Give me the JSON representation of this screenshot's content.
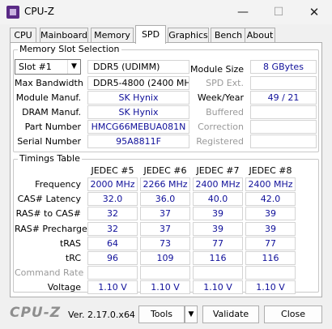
{
  "window": {
    "title": "CPU-Z",
    "minimize": "—",
    "maximize": "☐",
    "close": "✕"
  },
  "tabs": [
    "CPU",
    "Mainboard",
    "Memory",
    "SPD",
    "Graphics",
    "Bench",
    "About"
  ],
  "active_tab": "SPD",
  "slot_group": {
    "title": "Memory Slot Selection",
    "slot_select": "Slot #1",
    "memory_type": "DDR5 (UDIMM)",
    "max_bandwidth_label": "Max Bandwidth",
    "max_bandwidth": "DDR5-4800 (2400 MHz)",
    "manuf_label": "Module Manuf.",
    "manuf": "SK Hynix",
    "dram_manuf_label": "DRAM Manuf.",
    "dram_manuf": "SK Hynix",
    "part_label": "Part Number",
    "part": "HMCG66MEBUA081N",
    "serial_label": "Serial Number",
    "serial": "95A8811F",
    "module_size_label": "Module Size",
    "module_size": "8 GBytes",
    "spd_ext_label": "SPD Ext.",
    "spd_ext": "",
    "week_year_label": "Week/Year",
    "week_year": "49 / 21",
    "buffered_label": "Buffered",
    "buffered": "",
    "correction_label": "Correction",
    "correction": "",
    "registered_label": "Registered",
    "registered": ""
  },
  "timings": {
    "title": "Timings Table",
    "columns": [
      "JEDEC #5",
      "JEDEC #6",
      "JEDEC #7",
      "JEDEC #8"
    ],
    "rows": [
      {
        "label": "Frequency",
        "values": [
          "2000 MHz",
          "2266 MHz",
          "2400 MHz",
          "2400 MHz"
        ]
      },
      {
        "label": "CAS# Latency",
        "values": [
          "32.0",
          "36.0",
          "40.0",
          "42.0"
        ]
      },
      {
        "label": "RAS# to CAS#",
        "values": [
          "32",
          "37",
          "39",
          "39"
        ]
      },
      {
        "label": "RAS# Precharge",
        "values": [
          "32",
          "37",
          "39",
          "39"
        ]
      },
      {
        "label": "tRAS",
        "values": [
          "64",
          "73",
          "77",
          "77"
        ]
      },
      {
        "label": "tRC",
        "values": [
          "96",
          "109",
          "116",
          "116"
        ]
      },
      {
        "label": "Command Rate",
        "values": [
          "",
          "",
          "",
          ""
        ]
      },
      {
        "label": "Voltage",
        "values": [
          "1.10 V",
          "1.10 V",
          "1.10 V",
          "1.10 V"
        ]
      }
    ]
  },
  "footer": {
    "logo": "CPU-Z",
    "version": "Ver. 2.17.0.x64",
    "tools": "Tools",
    "tools_arrow": "▼",
    "validate": "Validate",
    "close": "Close"
  }
}
